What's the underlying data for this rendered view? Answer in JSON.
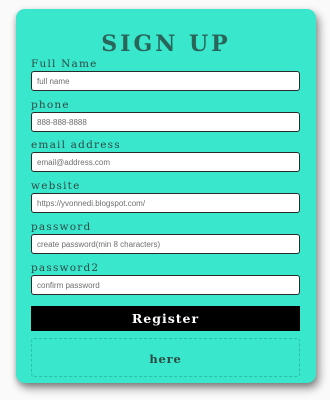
{
  "form": {
    "title": "SIGN UP",
    "fields": [
      {
        "label": "Full Name",
        "placeholder": "full name",
        "value": ""
      },
      {
        "label": "phone",
        "placeholder": "888-888-8888",
        "value": ""
      },
      {
        "label": "email address",
        "placeholder": "email@address.com",
        "value": ""
      },
      {
        "label": "website",
        "placeholder": "https://yvonnedi.blogspot.com/",
        "value": ""
      },
      {
        "label": "password",
        "placeholder": "create password(min 8 characters)",
        "value": ""
      },
      {
        "label": "password2",
        "placeholder": "confirm password",
        "value": ""
      }
    ],
    "register_label": "Register",
    "login_link_label": "here"
  },
  "colors": {
    "card_background": "#39e7cc",
    "title_text": "#2a6559",
    "button_background": "#000000",
    "page_background": "#fafafa"
  }
}
